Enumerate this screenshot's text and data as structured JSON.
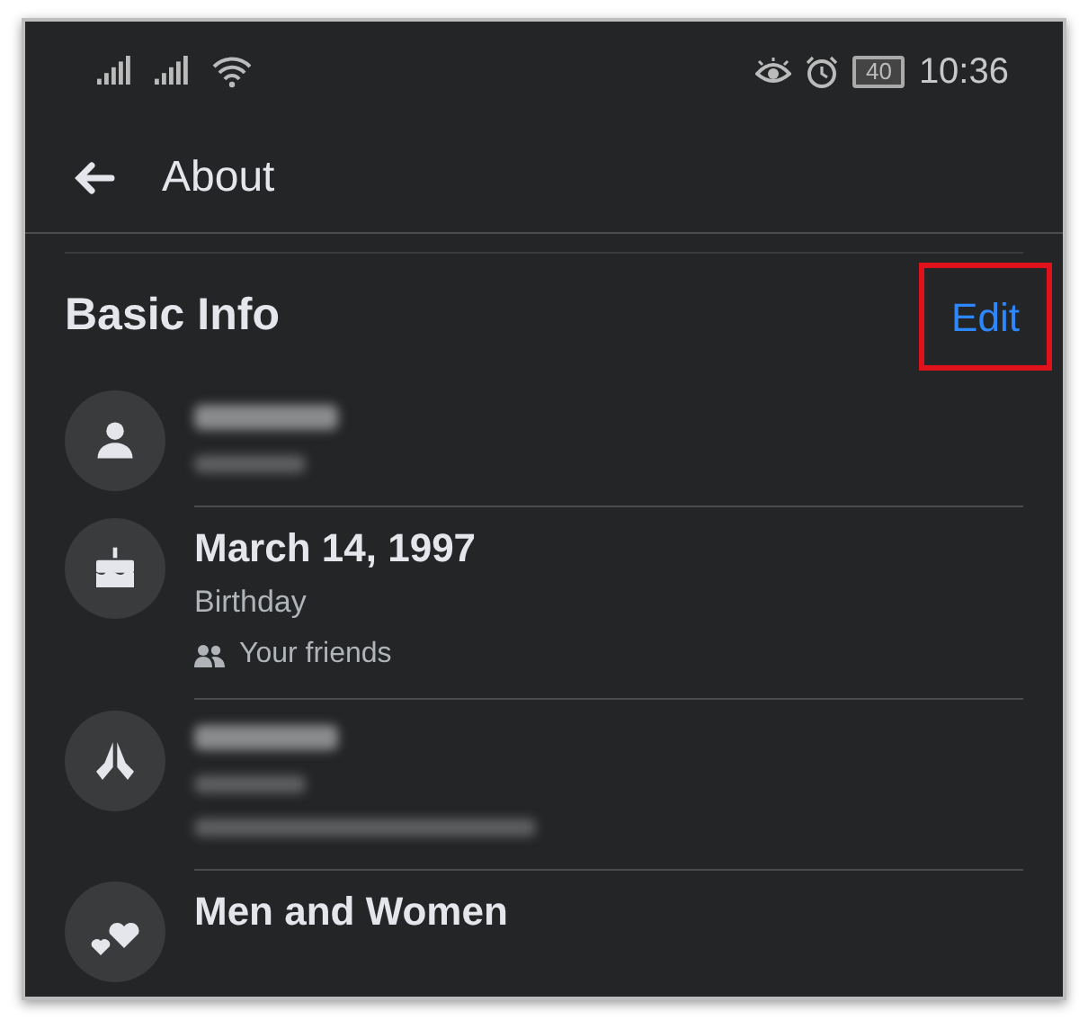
{
  "status_bar": {
    "time": "10:36",
    "battery": "40"
  },
  "header": {
    "title": "About"
  },
  "section": {
    "title": "Basic Info",
    "edit": "Edit",
    "highlighted": true
  },
  "items": [
    {
      "kind": "blurred",
      "has_audience": false
    },
    {
      "kind": "text",
      "title": "March 14, 1997",
      "subtitle": "Birthday",
      "audience": "Your friends"
    },
    {
      "kind": "blurred",
      "has_audience": true
    },
    {
      "kind": "text",
      "title": "Men and Women"
    }
  ]
}
